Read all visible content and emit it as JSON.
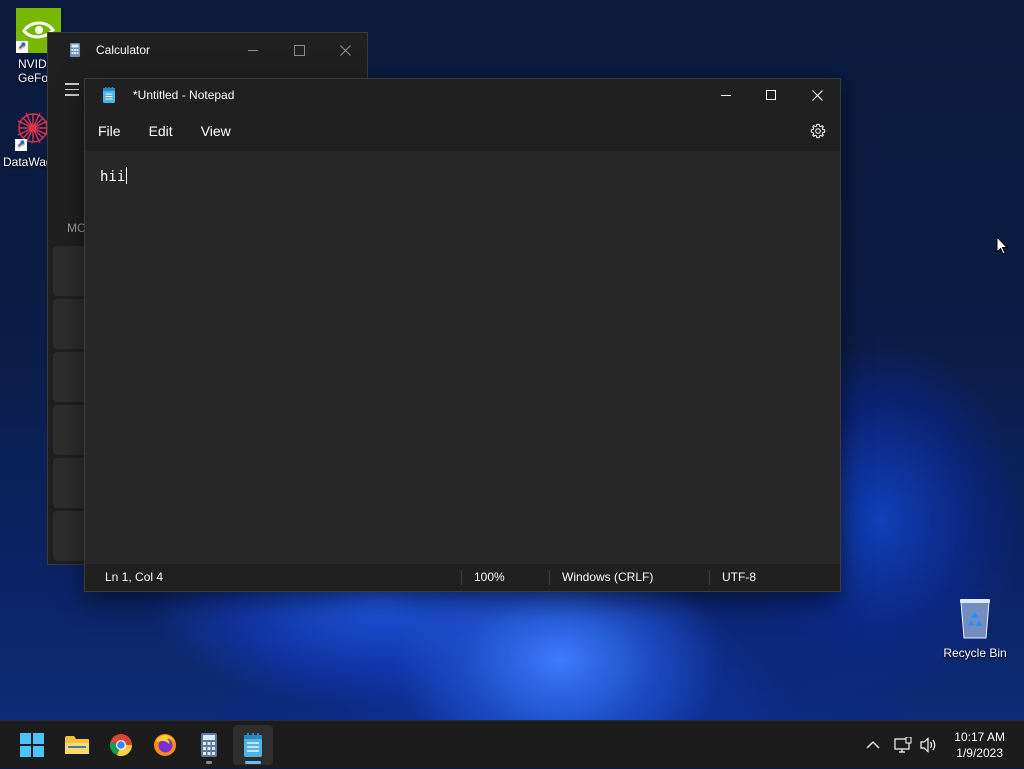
{
  "desktop": {
    "icons": [
      {
        "label": "NVIDIA GeForce",
        "visible_label": "NVIDI\nGeFor"
      },
      {
        "label": "DataWag",
        "visible_label": "DataWag"
      },
      {
        "label": "Recycle Bin",
        "visible_label": "Recycle Bin"
      }
    ]
  },
  "calculator": {
    "title": "Calculator",
    "memory_label": "MC"
  },
  "notepad": {
    "title": "*Untitled - Notepad",
    "menu": [
      "File",
      "Edit",
      "View"
    ],
    "content": "hii",
    "status": {
      "position": "Ln 1, Col 4",
      "zoom": "100%",
      "line_ending": "Windows (CRLF)",
      "encoding": "UTF-8"
    }
  },
  "taskbar": {
    "apps": [
      "start-icon",
      "file-explorer-icon",
      "chrome-icon",
      "firefox-icon",
      "calculator-icon",
      "notepad-icon"
    ],
    "active_app": "notepad",
    "clock": {
      "time": "10:17 AM",
      "date": "1/9/2023"
    }
  },
  "colors": {
    "accent": "#5ac2ff",
    "window_bg": "#272727",
    "chrome_bg": "#202020",
    "taskbar_bg": "#1c1c1c",
    "nvidia_green": "#76b900"
  }
}
